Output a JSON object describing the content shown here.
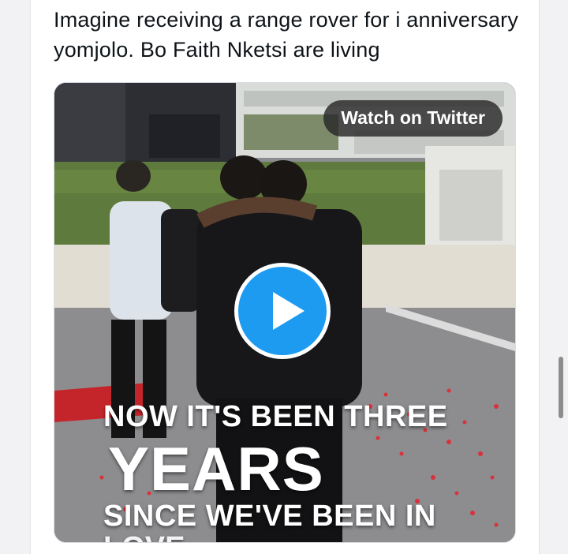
{
  "tweet": {
    "text": "Imagine receiving a range rover for i anniversary yomjolo. Bo Faith Nketsi are living"
  },
  "video": {
    "watch_label": "Watch on Twitter",
    "caption_line1": "NOW IT'S BEEN THREE",
    "caption_line2": "YEARS",
    "caption_line3": "SINCE WE'VE BEEN IN",
    "caption_line4": "LOVE"
  },
  "colors": {
    "play_button": "#1d9bf0",
    "text": "#0f1419",
    "card_bg": "#ffffff",
    "page_bg": "#f2f2f4"
  },
  "icons": {
    "play": "play-icon"
  }
}
